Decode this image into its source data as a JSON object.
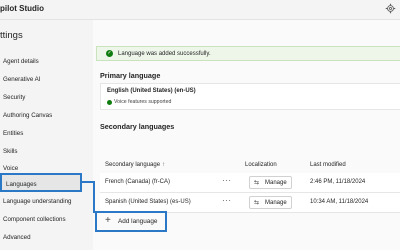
{
  "header": {
    "app_title": "pilot Studio",
    "settings_icon": "gear-icon"
  },
  "page": {
    "title": "ttings"
  },
  "sidebar": {
    "items": [
      {
        "label": "Agent details"
      },
      {
        "label": "Generative AI"
      },
      {
        "label": "Security"
      },
      {
        "label": "Authoring Canvas"
      },
      {
        "label": "Entities"
      },
      {
        "label": "Skills"
      },
      {
        "label": "Voice"
      },
      {
        "label": "Languages",
        "active": true
      },
      {
        "label": "Language understanding"
      },
      {
        "label": "Component collections"
      },
      {
        "label": "Advanced"
      }
    ]
  },
  "toast": {
    "message": "Language was added successfully.",
    "icon": "checkmark-circle-icon"
  },
  "primary": {
    "title": "Primary language",
    "language": "English (United States) (en-US)",
    "voice_note": "Voice features supported"
  },
  "secondary": {
    "title": "Secondary languages",
    "columns": {
      "language": "Secondary language",
      "localization": "Localization",
      "modified": "Last modified"
    },
    "rows": [
      {
        "language": "French (Canada) (fr-CA)",
        "action": "Manage",
        "modified": "2:46 PM, 11/18/2024"
      },
      {
        "language": "Spanish (United States) (es-US)",
        "action": "Manage",
        "modified": "10:34 AM, 11/18/2024"
      }
    ],
    "add_button": "Add language"
  },
  "colors": {
    "accent": "#2b78c6",
    "success": "#107c10",
    "toast_bg": "#eef6ea"
  }
}
